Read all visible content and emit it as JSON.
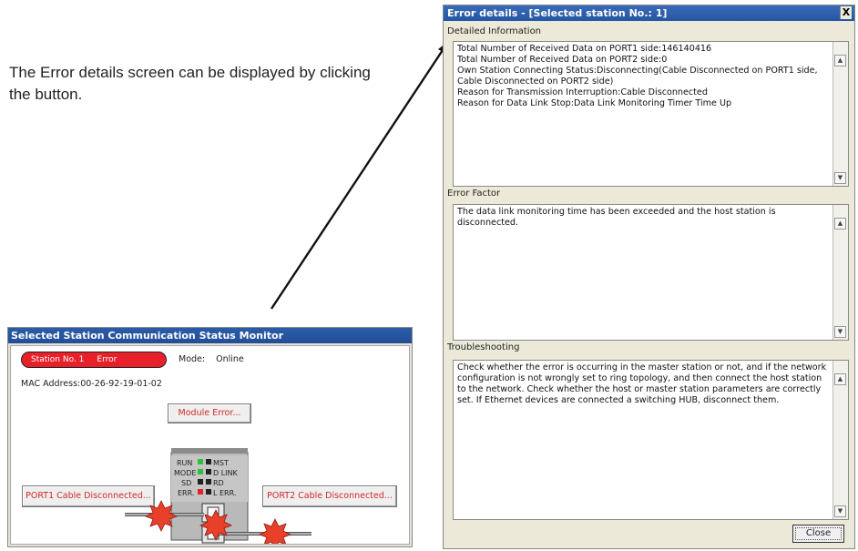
{
  "caption": "The Error details screen can be displayed by clicking the button.",
  "monitor": {
    "title": "Selected Station Communication Status Monitor",
    "station_label": "Station No. 1",
    "station_status": "Error",
    "mode_label": "Mode:",
    "mode_value": "Online",
    "mac_address": "MAC Address:00-26-92-19-01-02",
    "module_error_button": "Module Error...",
    "port1_button": "PORT1 Cable Disconnected...",
    "port2_button": "PORT2 Cable Disconnected...",
    "leds": {
      "run": "RUN",
      "mst": "MST",
      "mode": "MODE",
      "dlink": "D LINK",
      "sd": "SD",
      "rd": "RD",
      "err": "ERR.",
      "lerr": "L ERR."
    },
    "colors": {
      "led_green": "#2fbf3a",
      "led_red": "#e0242a",
      "led_off": "#222222",
      "star": "#e8402a"
    }
  },
  "error_dialog": {
    "title": "Error details - [Selected station No.: 1]",
    "close_x": "X",
    "detailed_label": "Detailed Information",
    "detailed_lines": [
      "Total Number of Received Data on PORT1 side:146140416",
      "Total Number of Received Data on PORT2 side:0",
      "Own Station Connecting Status:Disconnecting(Cable Disconnected on PORT1 side, Cable Disconnected on PORT2 side)",
      "Reason for Transmission Interruption:Cable Disconnected",
      "Reason for Data Link Stop:Data Link Monitoring Timer Time Up"
    ],
    "factor_label": "Error Factor",
    "factor_text": "The data link monitoring time has been exceeded and the host station is disconnected.",
    "troubleshooting_label": "Troubleshooting",
    "troubleshooting_text": "Check whether the error is occurring in the master station or not, and if the network configuration is not wrongly set to ring topology, and then connect the host station to the network. Check whether the host or master station parameters are correctly set. If Ethernet devices are connected a switching HUB, disconnect them.",
    "close_button": "Close"
  }
}
